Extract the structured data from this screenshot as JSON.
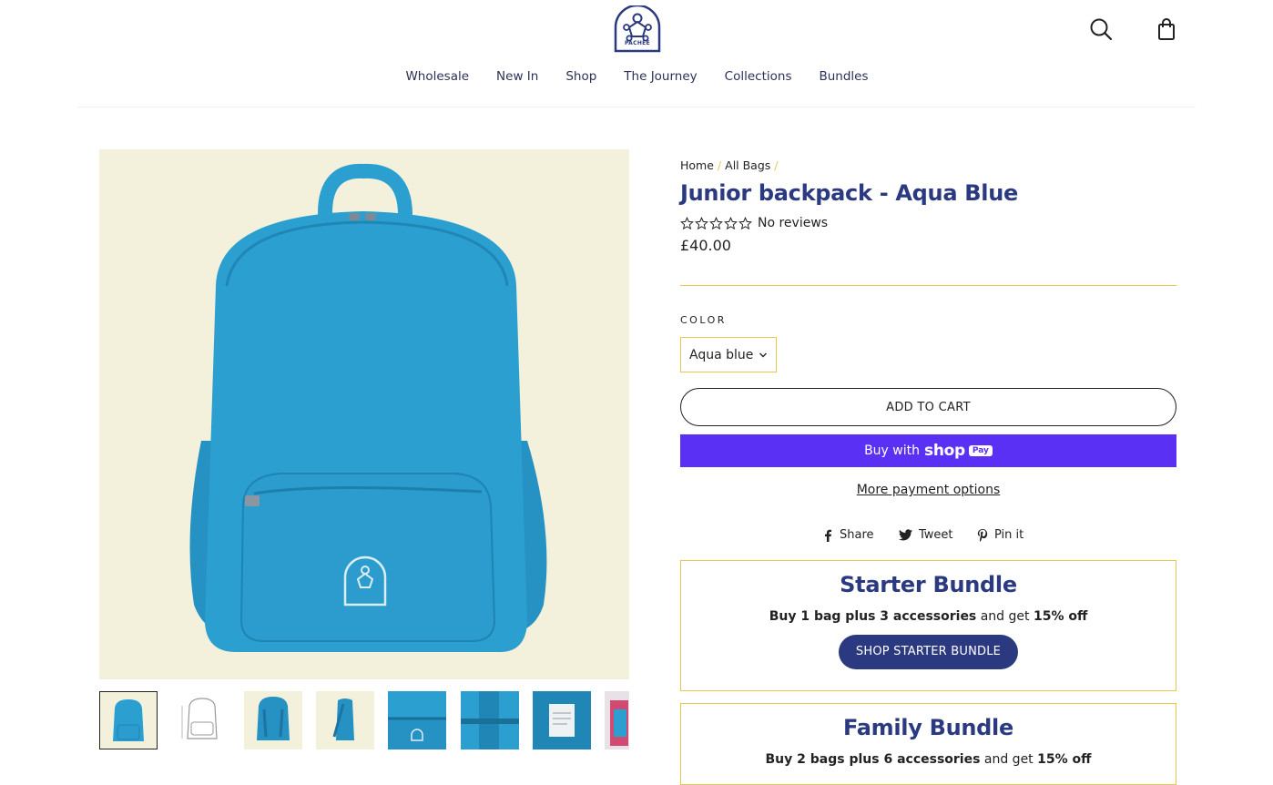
{
  "nav": [
    "Wholesale",
    "New In",
    "Shop",
    "The Journey",
    "Collections",
    "Bundles"
  ],
  "logo": {
    "text": "PACHEE"
  },
  "breadcrumb": {
    "home": "Home",
    "category": "All Bags",
    "sep": "/"
  },
  "product": {
    "title": "Junior backpack - Aqua Blue",
    "rating_text": "No reviews",
    "price": "£40.00",
    "color_label": "COLOR",
    "color_value": "Aqua blue",
    "add_to_cart": "ADD TO CART",
    "buy_with": "Buy with",
    "shop_word": "shop",
    "pay_word": "Pay",
    "more_payment": "More payment options"
  },
  "social": {
    "share": "Share",
    "tweet": "Tweet",
    "pin": "Pin it"
  },
  "bundles": [
    {
      "title": "Starter Bundle",
      "desc_a": "Buy 1 bag plus 3 accessories",
      "desc_b": " and get ",
      "desc_c": "15% off",
      "button": "SHOP STARTER BUNDLE"
    },
    {
      "title": "Family Bundle",
      "desc_a": "Buy 2 bags plus 6 accessories",
      "desc_b": " and get ",
      "desc_c": "15% off"
    }
  ],
  "colors": {
    "brand_navy": "#2b3a80",
    "accent_yellow": "#e8c84a",
    "shop_pay_purple": "#5a31f4",
    "product_blue": "#2a9fd0",
    "image_bg": "#f3f1dc"
  }
}
